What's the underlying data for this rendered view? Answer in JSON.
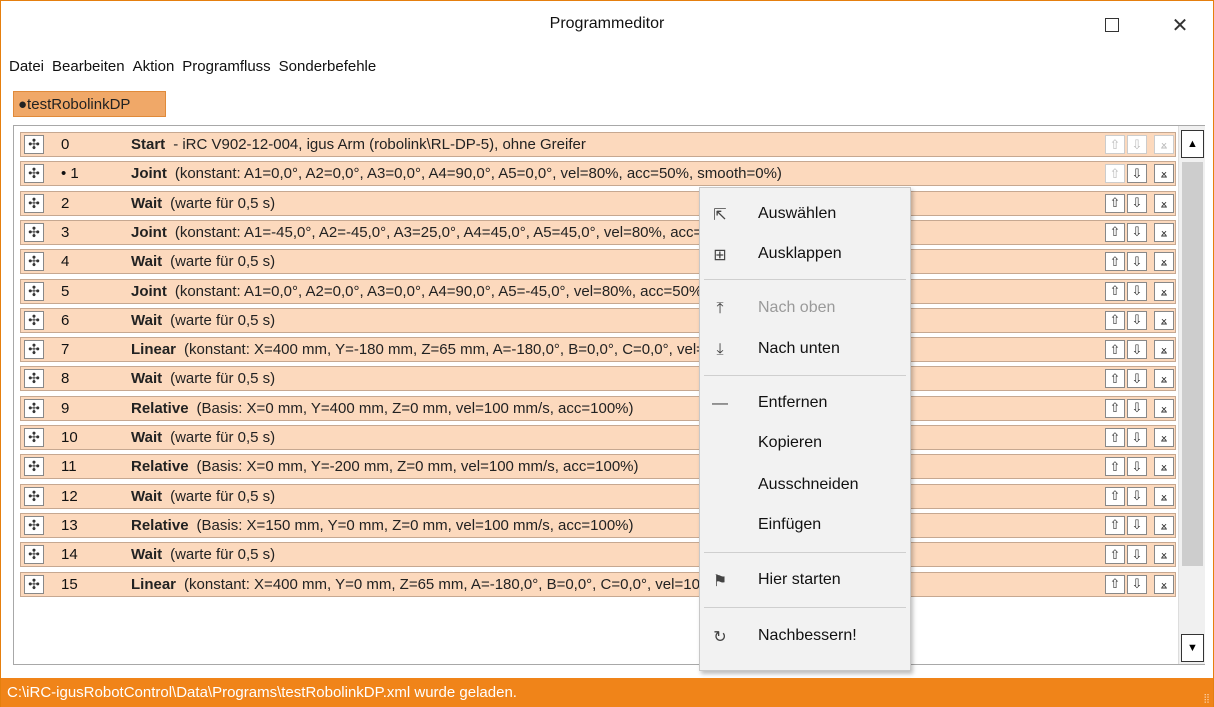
{
  "window": {
    "title": "Programmeditor"
  },
  "menubar": [
    "Datei",
    "Bearbeiten",
    "Aktion",
    "Programfluss",
    "Sonderbefehle"
  ],
  "tab": {
    "label": "●testRobolinkDP"
  },
  "rows": [
    {
      "num": "0",
      "cmd": "Start",
      "params": "- iRC V902-12-004, igus Arm (robolink\\RL-DP-5), ohne Greifer"
    },
    {
      "num": "• 1",
      "cmd": "Joint",
      "params": "(konstant: A1=0,0°, A2=0,0°, A3=0,0°, A4=90,0°, A5=0,0°, vel=80%, acc=50%, smooth=0%)"
    },
    {
      "num": "2",
      "cmd": "Wait",
      "params": "(warte für 0,5 s)"
    },
    {
      "num": "3",
      "cmd": "Joint",
      "params": "(konstant: A1=-45,0°, A2=-45,0°, A3=25,0°, A4=45,0°, A5=45,0°, vel=80%, acc=50%, smooth=0%)"
    },
    {
      "num": "4",
      "cmd": "Wait",
      "params": "(warte für 0,5 s)"
    },
    {
      "num": "5",
      "cmd": "Joint",
      "params": "(konstant: A1=0,0°, A2=0,0°, A3=0,0°, A4=90,0°, A5=-45,0°, vel=80%, acc=50%, smooth=0%)"
    },
    {
      "num": "6",
      "cmd": "Wait",
      "params": "(warte für 0,5 s)"
    },
    {
      "num": "7",
      "cmd": "Linear",
      "params": "(konstant: X=400 mm, Y=-180 mm, Z=65 mm, A=-180,0°, B=0,0°, C=0,0°, vel=100 mm/s, acc=100%,..."
    },
    {
      "num": "8",
      "cmd": "Wait",
      "params": "(warte für 0,5 s)"
    },
    {
      "num": "9",
      "cmd": "Relative",
      "params": "(Basis: X=0 mm, Y=400 mm, Z=0 mm, vel=100 mm/s, acc=100%)"
    },
    {
      "num": "10",
      "cmd": "Wait",
      "params": "(warte für 0,5 s)"
    },
    {
      "num": "11",
      "cmd": "Relative",
      "params": "(Basis: X=0 mm, Y=-200 mm, Z=0 mm, vel=100 mm/s, acc=100%)"
    },
    {
      "num": "12",
      "cmd": "Wait",
      "params": "(warte für 0,5 s)"
    },
    {
      "num": "13",
      "cmd": "Relative",
      "params": "(Basis: X=150 mm, Y=0 mm, Z=0 mm, vel=100 mm/s, acc=100%)"
    },
    {
      "num": "14",
      "cmd": "Wait",
      "params": "(warte für 0,5 s)"
    },
    {
      "num": "15",
      "cmd": "Linear",
      "params": "(konstant: X=400 mm, Y=0 mm, Z=65 mm, A=-180,0°, B=0,0°, C=0,0°, vel=100 mm/s, acc=100%,..."
    }
  ],
  "context_menu": [
    {
      "label": "Auswählen",
      "icon": "pointer-icon",
      "glyph": "⇱"
    },
    {
      "label": "Ausklappen",
      "icon": "expand-icon",
      "glyph": "⊞"
    },
    {
      "label": "Nach oben",
      "icon": "move-top-icon",
      "glyph": "⤒"
    },
    {
      "label": "Nach unten",
      "icon": "move-bottom-icon",
      "glyph": "⤓"
    },
    {
      "label": "Entfernen",
      "icon": "minus-icon",
      "glyph": "—"
    },
    {
      "label": "Kopieren",
      "icon": "",
      "glyph": ""
    },
    {
      "label": "Ausschneiden",
      "icon": "",
      "glyph": ""
    },
    {
      "label": "Einfügen",
      "icon": "",
      "glyph": ""
    },
    {
      "label": "Hier starten",
      "icon": "flag-icon",
      "glyph": "⚑"
    },
    {
      "label": "Nachbessern!",
      "icon": "refresh-icon",
      "glyph": "↻"
    }
  ],
  "status": {
    "text": "C:\\iRC-igusRobotControl\\Data\\Programs\\testRobolinkDP.xml wurde geladen."
  },
  "colors": {
    "accent": "#f08419",
    "row_bg": "#fcd9bd",
    "tab_bg": "#f0a868"
  }
}
